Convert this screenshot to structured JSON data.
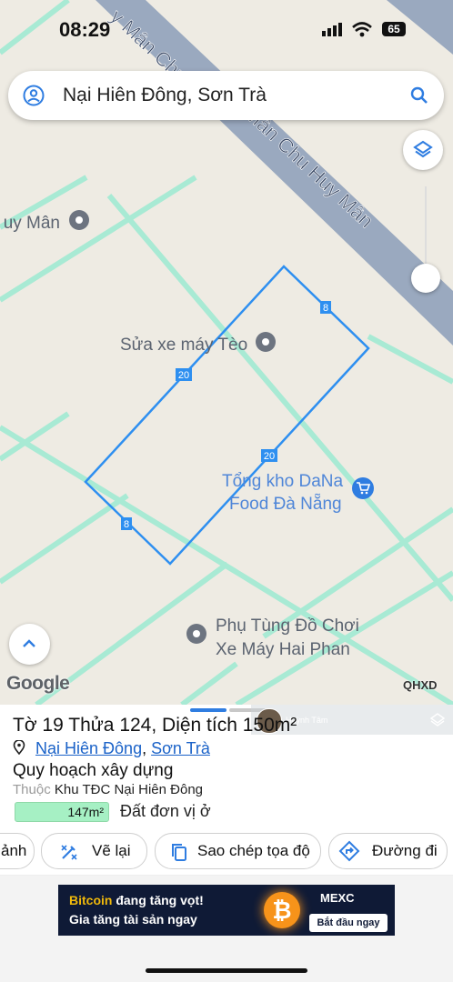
{
  "status_bar": {
    "time": "08:29",
    "battery": "65"
  },
  "search": {
    "query": "Nại Hiên Đông, Sơn Trà"
  },
  "map": {
    "road_name": "Chu Huy Mân",
    "road_labels": [
      "y Mân Chu",
      "y Mân Chu Huy Mân",
      "y Mân"
    ],
    "pois": [
      {
        "name": "uy Mân",
        "icon": "place-pin-icon"
      },
      {
        "name": "Sửa xe máy Tèo",
        "icon": "place-pin-icon"
      },
      {
        "name": "Tổng kho DaNa",
        "name_line2": "Food Đà Nẵng",
        "icon": "shopping-cart-icon"
      },
      {
        "name": "Phụ Tùng Đồ Chơi",
        "name_line2": "Xe Máy Hai Phan",
        "icon": "place-pin-icon"
      }
    ],
    "parcel_edge_labels": [
      "8",
      "20",
      "20",
      "8"
    ],
    "google_logo": "Google",
    "layer_tag": "QHXD"
  },
  "parcel": {
    "title": "Tờ 19 Thửa 124, Diện tích 150m²",
    "ward": "Nại Hiên Đông",
    "district": "Sơn Trà",
    "separator": ",",
    "plan_title": "Quy hoạch xây dựng",
    "belongs_label": "Thuộc",
    "belongs_value": "Khu TĐC Nại Hiên Đông",
    "area_value": "147m²",
    "area_use": "Đất đơn vị ở",
    "overlay_name": "Huỳnh Tâm"
  },
  "actions": [
    {
      "label": "ảnh",
      "icon": "image-icon"
    },
    {
      "label": "Vẽ lại",
      "icon": "redraw-icon"
    },
    {
      "label": "Sao chép tọa độ",
      "icon": "copy-icon"
    },
    {
      "label": "Đường đi",
      "icon": "directions-icon"
    }
  ],
  "ad": {
    "line1_highlight": "Bitcoin",
    "line1_rest": " đang tăng vọt!",
    "line2": "Gia tăng tài sản ngay",
    "brand": "MEXC",
    "cta": "Bắt đầu ngay",
    "coin_symbol": "₿"
  },
  "colors": {
    "map_background": "#eeebe3",
    "minor_road": "#a8ead4",
    "major_road": "#9aa9bf",
    "parcel_outline": "#2e8ff0",
    "link": "#1a62c8",
    "area_badge": "#a6f0c4"
  }
}
